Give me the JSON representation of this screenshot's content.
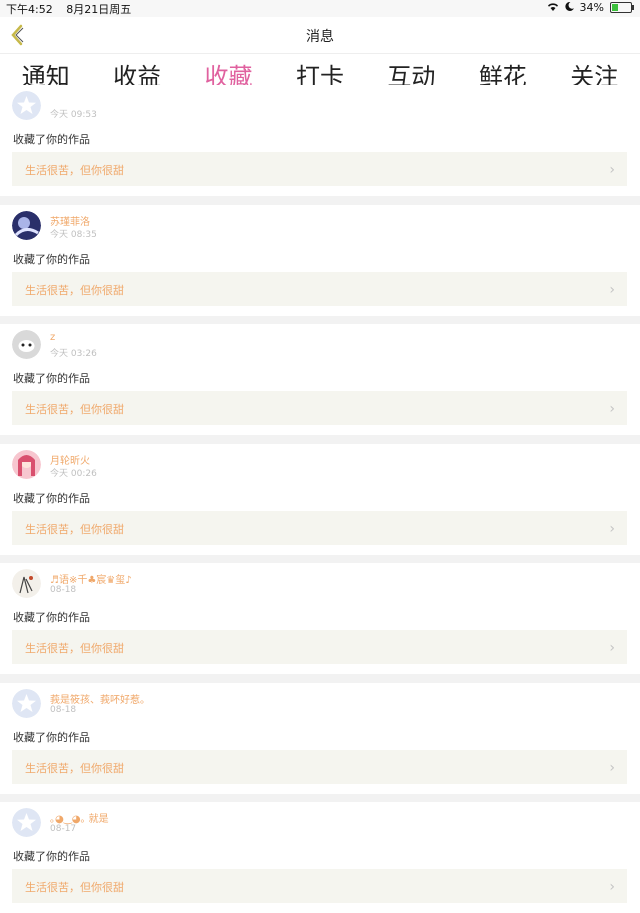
{
  "status": {
    "time": "下午4:52",
    "date": "8月21日周五",
    "battery": "34%",
    "battery_level": 0.34
  },
  "nav": {
    "title": "消息"
  },
  "tabs": [
    {
      "label": "通知",
      "active": false
    },
    {
      "label": "收益",
      "active": false
    },
    {
      "label": "收藏",
      "active": true
    },
    {
      "label": "打卡",
      "active": false
    },
    {
      "label": "互动",
      "active": false
    },
    {
      "label": "鲜花",
      "active": false
    },
    {
      "label": "关注",
      "active": false
    }
  ],
  "items": [
    {
      "name": "",
      "time": "今天 09:53",
      "action": "收藏了你的作品",
      "work": "生活很苦，但你很甜",
      "avatar": "default"
    },
    {
      "name": "苏瑾菲洛",
      "time": "今天 08:35",
      "action": "收藏了你的作品",
      "work": "生活很苦，但你很甜",
      "avatar": "photo-blue"
    },
    {
      "name": "z",
      "time": "今天 03:26",
      "action": "收藏了你的作品",
      "work": "生活很苦，但你很甜",
      "avatar": "photo-gray"
    },
    {
      "name": "月轮昕火",
      "time": "今天 00:26",
      "action": "收藏了你的作品",
      "work": "生活很苦，但你很甜",
      "avatar": "photo-pink"
    },
    {
      "name": "♬语※千♣宸♛玺♪",
      "time": "08-18",
      "action": "收藏了你的作品",
      "work": "生活很苦，但你很甜",
      "avatar": "photo-sketch"
    },
    {
      "name": "莪是筱孩、莪吥好惹。",
      "time": "08-18",
      "action": "收藏了你的作品",
      "work": "生活很苦，但你很甜",
      "avatar": "default"
    },
    {
      "name": "｡◕‿◕｡ 就是",
      "time": "08-17",
      "action": "收藏了你的作品",
      "work": "生活很苦，但你很甜",
      "avatar": "default"
    }
  ]
}
